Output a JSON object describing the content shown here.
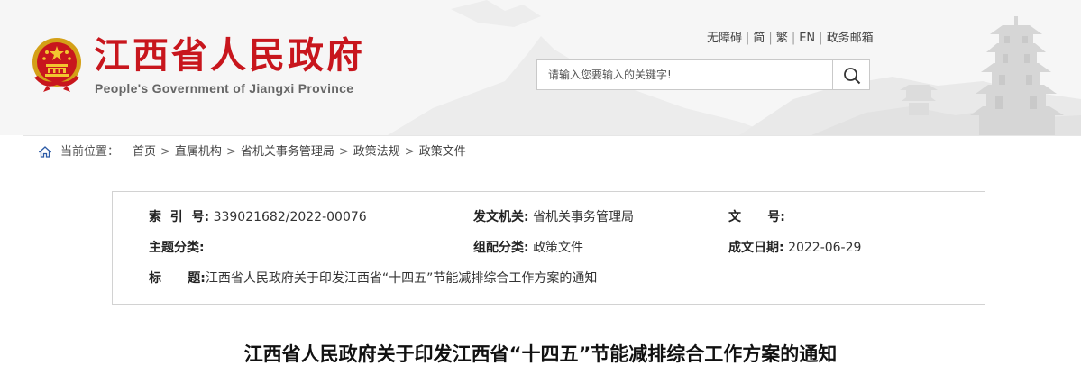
{
  "header": {
    "title": "江西省人民政府",
    "subtitle": "People's Government of Jiangxi Province",
    "top_links": [
      "无障碍",
      "简",
      "繁",
      "EN",
      "政务邮箱"
    ],
    "search": {
      "placeholder": "请输入您要输入的关键字!",
      "button_icon": "search-icon"
    }
  },
  "breadcrumb": {
    "label": "当前位置：",
    "items": [
      "首页",
      "直属机构",
      "省机关事务管理局",
      "政策法规",
      "政策文件"
    ],
    "separator": ">"
  },
  "info": {
    "index_label": "索  引  号:",
    "index_value": "339021682/2022-00076",
    "issuer_label": "发文机关:",
    "issuer_value": "省机关事务管理局",
    "docno_label": "文      号:",
    "docno_value": "",
    "topic_label": "主题分类:",
    "topic_value": "",
    "category_label": "组配分类:",
    "category_value": "政策文件",
    "date_label": "成文日期:",
    "date_value": "2022-06-29",
    "title_label": "标      题:",
    "title_value": "江西省人民政府关于印发江西省“十四五”节能减排综合工作方案的通知"
  },
  "article": {
    "title": "江西省人民政府关于印发江西省“十四五”节能减排综合工作方案的通知"
  },
  "colors": {
    "brand_red": "#c8161d",
    "header_bg": "#f6f6f6",
    "border": "#d2d2d2"
  }
}
